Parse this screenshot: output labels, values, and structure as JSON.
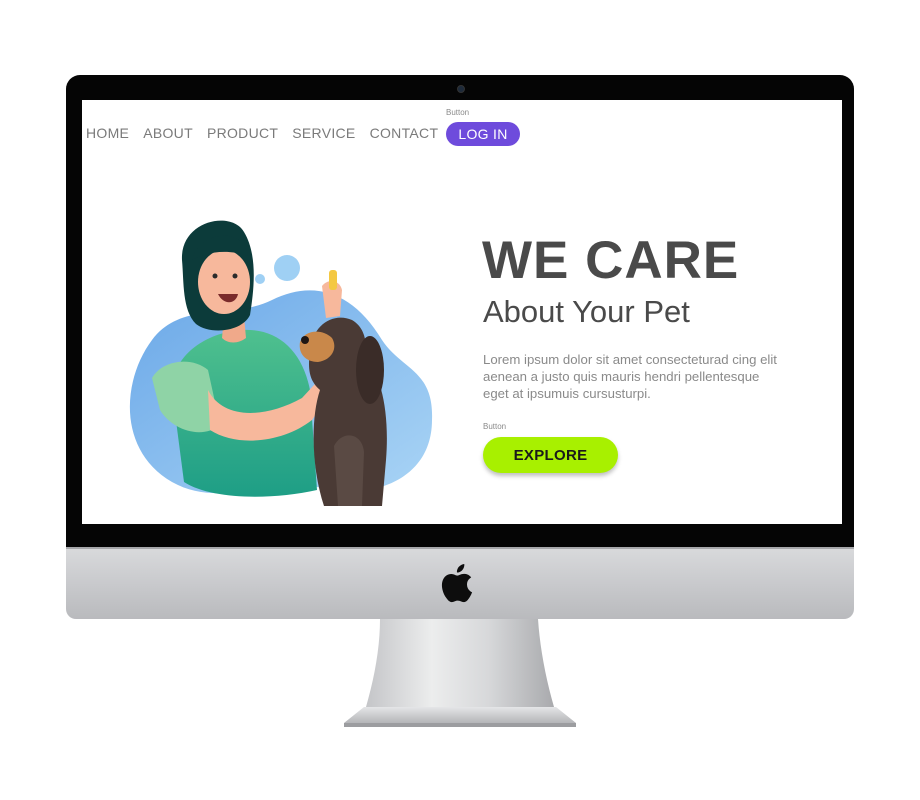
{
  "nav": {
    "items": [
      "HOME",
      "ABOUT",
      "PRODUCT",
      "SERVICE",
      "CONTACT"
    ],
    "login_caption": "Button",
    "login_label": "LOG IN"
  },
  "hero": {
    "title": "WE CARE",
    "subtitle": "About Your Pet",
    "body": "Lorem ipsum dolor sit amet consecteturad cing elit aenean a justo quis mauris hendri pellentesque eget at ipsumuis cursusturpi.",
    "explore_caption": "Button",
    "explore_label": "EXPLORE"
  },
  "colors": {
    "login_button": "#6e4bdc",
    "explore_button": "#a8f000",
    "heading": "#4a4a4a",
    "body_text": "#8a8a8a"
  },
  "icons": {
    "brand": "apple-logo-icon",
    "illustration": "vet-with-dog-illustration"
  }
}
